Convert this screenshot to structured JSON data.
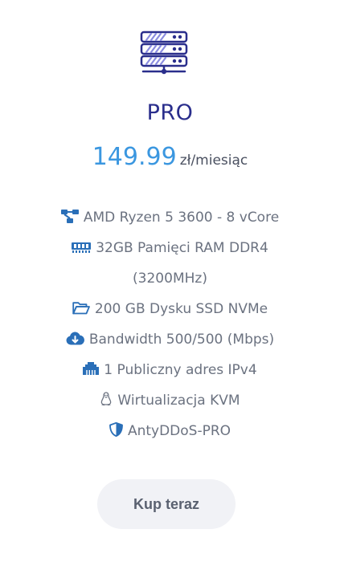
{
  "plan": {
    "name": "PRO",
    "price": "149.99",
    "price_unit": "zł/miesiąc"
  },
  "features": [
    {
      "icon": "network-icon",
      "text": "AMD Ryzen 5 3600 - 8 vCore"
    },
    {
      "icon": "memory-icon",
      "text": "32GB Pamięci RAM DDR4"
    },
    {
      "icon": "",
      "text": "(3200MHz)"
    },
    {
      "icon": "folder-icon",
      "text": "200 GB Dysku SSD NVMe"
    },
    {
      "icon": "cloud-download-icon",
      "text": "Bandwidth 500/500 (Mbps)"
    },
    {
      "icon": "ethernet-icon",
      "text": "1 Publiczny adres IPv4"
    },
    {
      "icon": "linux-icon",
      "text": "Wirtualizacja KVM"
    },
    {
      "icon": "shield-icon",
      "text": "AntyDDoS-PRO"
    }
  ],
  "cta": {
    "label": "Kup teraz"
  },
  "colors": {
    "title": "#2a2e8c",
    "price": "#3b97e0",
    "icon_accent": "#2a6fb8",
    "button_bg": "#f1f2f6"
  }
}
